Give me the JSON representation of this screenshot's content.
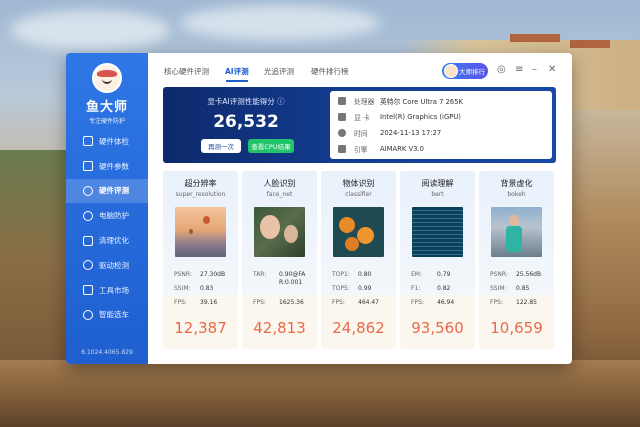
{
  "app": {
    "name": "鱼大师",
    "slogan": "专注硬件防护",
    "version": "6.1024.4065.829"
  },
  "sidebar": {
    "items": [
      {
        "label": "硬件体检",
        "icon": "checkup-icon",
        "active": false
      },
      {
        "label": "硬件参数",
        "icon": "params-icon",
        "active": false
      },
      {
        "label": "硬件评测",
        "icon": "benchmark-icon",
        "active": true
      },
      {
        "label": "电脑防护",
        "icon": "shield-icon",
        "active": false
      },
      {
        "label": "清理优化",
        "icon": "cleanup-icon",
        "active": false
      },
      {
        "label": "驱动检测",
        "icon": "driver-icon",
        "active": false
      },
      {
        "label": "工具市场",
        "icon": "tools-icon",
        "active": false
      },
      {
        "label": "智能选车",
        "icon": "car-icon",
        "active": false
      }
    ]
  },
  "tabs": [
    {
      "label": "核心硬件评测",
      "active": false
    },
    {
      "label": "AI评测",
      "active": true
    },
    {
      "label": "光追评测",
      "active": false
    },
    {
      "label": "硬件排行榜",
      "active": false
    }
  ],
  "header": {
    "rank_button": "大师排行"
  },
  "score": {
    "title": "显卡AI评测性能得分 ⓘ",
    "value": "26,532",
    "retest_label": "再测一次",
    "cpu_result_label": "查看CPU结果"
  },
  "info": {
    "rows": [
      {
        "label": "处理器",
        "value": "英特尔 Core Ultra 7 265K",
        "icon": "cpu-icon"
      },
      {
        "label": "显  卡",
        "value": "Intel(R) Graphics (iGPU)",
        "icon": "gpu-icon"
      },
      {
        "label": "时间",
        "value": "2024-11-13 17:27",
        "icon": "clock-icon"
      },
      {
        "label": "引擎",
        "value": "AIMARK V3.0",
        "icon": "engine-icon"
      }
    ]
  },
  "cards": [
    {
      "title": "超分辨率",
      "subtitle": "super_resolution",
      "metrics": [
        {
          "k": "PSNR:",
          "v": "27.30dB"
        },
        {
          "k": "SSIM:",
          "v": "0.83"
        },
        {
          "k": "FPS:",
          "v": "39.16"
        }
      ],
      "score": "12,387",
      "thumb": "balloons-image"
    },
    {
      "title": "人脸识别",
      "subtitle": "face_net",
      "metrics": [
        {
          "k": "TAR:",
          "v": "0.90@FA R:0.001"
        },
        {
          "k": "",
          "v": ""
        },
        {
          "k": "FPS:",
          "v": "1625.36"
        }
      ],
      "score": "42,813",
      "thumb": "faces-image"
    },
    {
      "title": "物体识别",
      "subtitle": "classifier",
      "metrics": [
        {
          "k": "TOP1:",
          "v": "0.80"
        },
        {
          "k": "TOP5:",
          "v": "0.99"
        },
        {
          "k": "FPS:",
          "v": "464.47"
        }
      ],
      "score": "24,862",
      "thumb": "oranges-image"
    },
    {
      "title": "阅读理解",
      "subtitle": "bert",
      "metrics": [
        {
          "k": "EM:",
          "v": "0.79"
        },
        {
          "k": "F1:",
          "v": "0.82"
        },
        {
          "k": "FPS:",
          "v": "46.94"
        }
      ],
      "score": "93,560",
      "thumb": "code-image"
    },
    {
      "title": "背景虚化",
      "subtitle": "bokeh",
      "metrics": [
        {
          "k": "PSNR:",
          "v": "25.56dB"
        },
        {
          "k": "SSIM:",
          "v": "0.85"
        },
        {
          "k": "FPS:",
          "v": "122.85"
        }
      ],
      "score": "10,659",
      "thumb": "person-image"
    }
  ],
  "colors": {
    "sidebar": "#2a6fe0",
    "accent": "#1f5fd0",
    "score_text": "#e86a4a",
    "cpu_button": "#21c36b"
  }
}
